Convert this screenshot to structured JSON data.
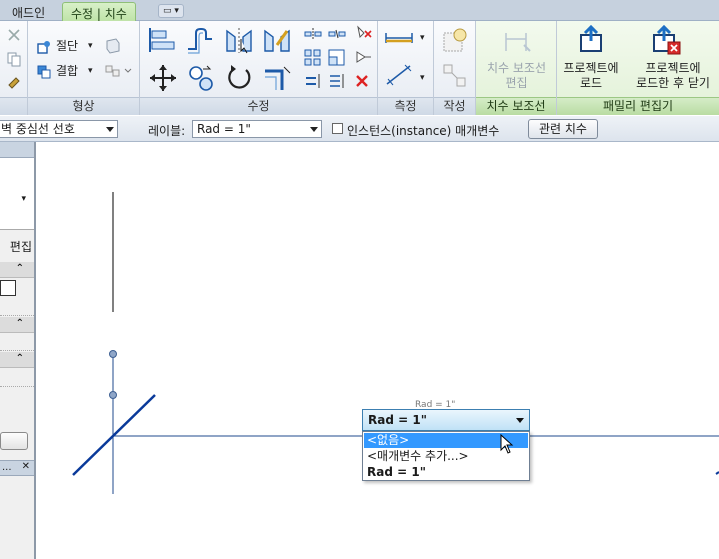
{
  "tabs": {
    "addin": "애드인",
    "modify_dim": "수정 | 치수",
    "quick": "▭ ▾"
  },
  "ribbon": {
    "groups": {
      "geometry": "형상",
      "modify": "수정",
      "measure": "측정",
      "create": "작성",
      "dim_witness": "치수 보조선",
      "family_editor": "패밀리 편집기"
    },
    "geometry": {
      "cut": "절단",
      "join": "결합"
    },
    "dim_witness": {
      "edit_line1": "치수 보조선",
      "edit_line2": "편집"
    },
    "family_editor": {
      "load_line1": "프로젝트에",
      "load_line2": "로드",
      "load_close_line1": "프로젝트에",
      "load_close_line2": "로드한 후 닫기"
    }
  },
  "optionsbar": {
    "prefer": "벽 중심선 선호",
    "label_caption": "레이블:",
    "label_value": "Rad = 1\"",
    "instance_param": "인스턴스(instance) 매개변수",
    "related_dims": "관련 치수"
  },
  "leftpanel": {
    "edit_type": "편집",
    "dots": "..."
  },
  "canvas": {
    "dim_ghost": "Rad = 1\"",
    "dropdown_value": "Rad = 1\"",
    "options": [
      "<없음>",
      "<매개변수 추가...>",
      "Rad = 1\""
    ]
  },
  "colors": {
    "ribbon_green": "#bfe3a8",
    "selection": "#3399ff",
    "reference_line": "#1f4a8c",
    "geometry_line": "#0a3a9a"
  }
}
